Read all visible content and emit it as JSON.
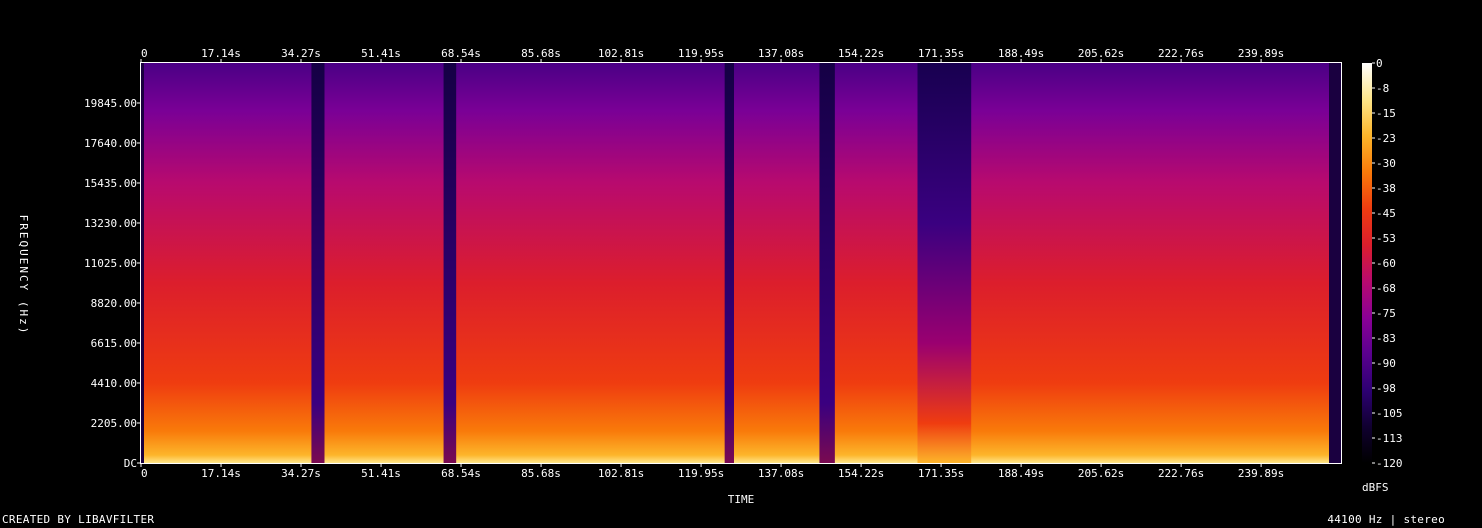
{
  "chart_data": {
    "type": "heatmap",
    "xlabel": "TIME",
    "ylabel": "FREQUENCY (Hz)",
    "x_tick_labels": [
      "0",
      "17.14s",
      "34.27s",
      "51.41s",
      "68.54s",
      "85.68s",
      "102.81s",
      "119.95s",
      "137.08s",
      "154.22s",
      "171.35s",
      "188.49s",
      "205.62s",
      "222.76s",
      "239.89s"
    ],
    "x_tick_values": [
      0,
      17.14,
      34.27,
      51.41,
      68.54,
      85.68,
      102.81,
      119.95,
      137.08,
      154.22,
      171.35,
      188.49,
      205.62,
      222.76,
      239.89
    ],
    "xlim": [
      0,
      257.0
    ],
    "y_tick_labels": [
      "DC",
      "2205.00",
      "4410.00",
      "6615.00",
      "8820.00",
      "11025.00",
      "13230.00",
      "15435.00",
      "17640.00",
      "19845.00"
    ],
    "y_tick_values": [
      0,
      2205,
      4410,
      6615,
      8820,
      11025,
      13230,
      15435,
      17640,
      19845
    ],
    "ylim": [
      0,
      22050
    ],
    "colorbar": {
      "label": "dBFS",
      "tick_labels": [
        "0",
        "-8",
        "-15",
        "-23",
        "-30",
        "-38",
        "-45",
        "-53",
        "-60",
        "-68",
        "-75",
        "-83",
        "-90",
        "-98",
        "-105",
        "-113",
        "-120"
      ],
      "range": [
        -120,
        0
      ]
    },
    "colormap": [
      "#000000",
      "#100030",
      "#2d0073",
      "#5a008f",
      "#8b0096",
      "#b80a6e",
      "#dc1e2c",
      "#ef3c10",
      "#f97a0a",
      "#fdb52a",
      "#fee68a",
      "#ffffff"
    ],
    "quiet_segments_s": [
      [
        36.5,
        39.3
      ],
      [
        64.8,
        67.5
      ],
      [
        125.0,
        127.0
      ],
      [
        145.3,
        148.6
      ]
    ],
    "sparse_segments_s": [
      [
        166.3,
        177.8
      ]
    ]
  },
  "footer": {
    "left": "CREATED BY LIBAVFILTER",
    "right": "44100 Hz | stereo"
  }
}
